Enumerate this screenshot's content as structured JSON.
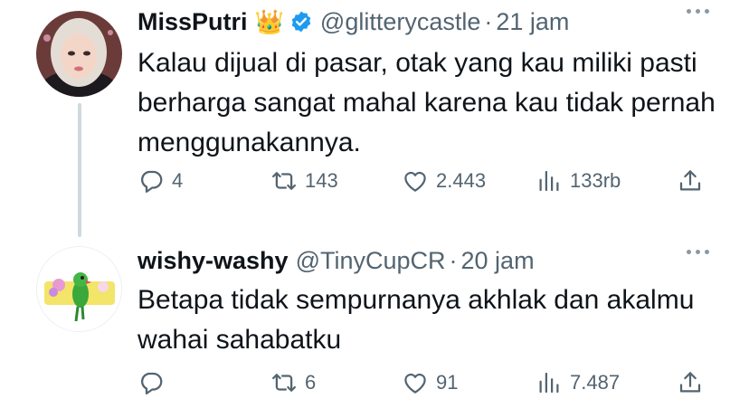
{
  "tweets": [
    {
      "name": "MissPutri",
      "crown": "👑",
      "handle": "@glitterycastle",
      "dot": "·",
      "time": "21 jam",
      "text": "Kalau dijual di pasar, otak yang kau miliki pasti berharga sangat mahal karena kau tidak pernah menggunakannya.",
      "replies": "4",
      "retweets": "143",
      "likes": "2.443",
      "views": "133rb"
    },
    {
      "name": "wishy-washy",
      "handle": "@TinyCupCR",
      "dot": "·",
      "time": "20 jam",
      "text": "Betapa tidak sempurnanya akhlak dan akalmu wahai sahabatku",
      "replies": "",
      "retweets": "6",
      "likes": "91",
      "views": "7.487"
    }
  ],
  "colors": {
    "text": "#0f1419",
    "secondary": "#536471",
    "verified": "#1d9bf0",
    "thread_line": "#cfd9de"
  },
  "icons": [
    "reply-icon",
    "retweet-icon",
    "like-icon",
    "views-icon",
    "share-icon",
    "more-icon",
    "verified-badge-icon"
  ]
}
